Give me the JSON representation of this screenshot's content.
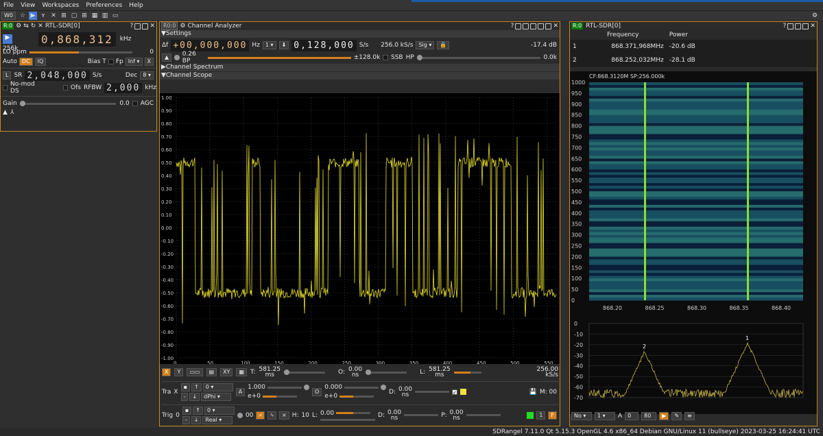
{
  "menu": [
    "File",
    "View",
    "Workspaces",
    "Preferences",
    "Help"
  ],
  "toolbar": {
    "workspace": "W0"
  },
  "rx": {
    "badge": "R:0",
    "device": "RTL-SDR[0]",
    "rate": "256k",
    "freq": "0,868,312",
    "freq_unit": "kHz",
    "lo_label": "LO ppm",
    "lo_value": "0",
    "auto": "Auto",
    "dc": "DC",
    "iq": "IQ",
    "biast": "Bias T",
    "fp": "Fp",
    "inf": "Inf",
    "x": "X",
    "l": "L",
    "sr": "SR",
    "sr_value": "2,048,000",
    "sr_unit": "S/s",
    "dec": "Dec",
    "dec_value": "8",
    "nomod": "No-mod DS",
    "ofs": "Ofs",
    "rfbw": "RFBW",
    "rfbw_value": "2,000",
    "rfbw_unit": "kHz",
    "gain": "Gain",
    "gain_value": "0.0",
    "agc": "AGC"
  },
  "ca": {
    "badge": "R0:0",
    "title": "Channel Analyzer",
    "settings": "Settings",
    "df": "Δf",
    "df_value": "+00,000,000",
    "hz": "Hz",
    "step": "1",
    "rate_value": "0,128,000",
    "rate_unit": "S/s",
    "rate_sel": "256.0 kS/s",
    "sig": "Sig",
    "db": "-17.4 dB",
    "bp": "0.26 BP",
    "bw": "±128.0k",
    "ssb": "SSB",
    "hp": "HP",
    "hp_val": "0.0k",
    "spectrum": "Channel Spectrum",
    "scope": "Channel Scope",
    "y_ticks": [
      "1.00",
      "0.90",
      "0.80",
      "0.70",
      "0.60",
      "0.50",
      "0.40",
      "0.30",
      "0.20",
      "0.10",
      "0.00",
      "-0.10",
      "-0.20",
      "-0.30",
      "-0.40",
      "-0.50",
      "-0.60",
      "-0.70",
      "-0.80",
      "-0.90",
      "-1.00"
    ],
    "x_ticks": [
      "0",
      "50",
      "100",
      "150",
      "200",
      "250",
      "300",
      "350",
      "400",
      "450",
      "500",
      "550"
    ],
    "controls": {
      "xbtn": "X",
      "ybtn": "Y",
      "xy": "XY",
      "t_label": "T:",
      "t_val": "581.25",
      "t_unit": "ms",
      "o_label": "O:",
      "o_val": "0.00",
      "o_unit": "ns",
      "l_label": "L:",
      "l_val": "581.25",
      "l_unit": "ms",
      "rate": "256.00",
      "rate_unit": "kS/s",
      "tra": "Tra",
      "tra_x": "X",
      "tra_sel": "0",
      "dphi": "dPhi",
      "a": "A",
      "a_val": "1.000",
      "e0": "e+0",
      "o2": "O",
      "o2_val": "0.000",
      "e0b": "e+0",
      "d": "D:",
      "d_val": "0.00",
      "d_unit": "ns",
      "m": "M: 00",
      "trig": "Trig",
      "trig_n": "0",
      "trig_sel": "0",
      "real": "Real",
      "trig_cnt": "00",
      "h": "H:",
      "h_val": "10",
      "l2": "L:",
      "l2_val": "0.00",
      "d2": "D:",
      "d2_val": "0.00",
      "d2_unit": "ns",
      "p": "P:",
      "p_val": "0.00",
      "p_unit": "ns",
      "one": "1",
      "f": "F"
    }
  },
  "sa": {
    "badge": "R:0",
    "device": "RTL-SDR[0]",
    "cols": [
      "Frequency",
      "Power"
    ],
    "rows": [
      {
        "n": "1",
        "freq": "868.371,968MHz",
        "pow": "-20.6 dB"
      },
      {
        "n": "2",
        "freq": "868.252,032MHz",
        "pow": "-28.1 dB"
      }
    ],
    "wf_header": "CF:868.3120M SP:256.000k",
    "wf_y": [
      "1000",
      "950",
      "900",
      "850",
      "800",
      "750",
      "700",
      "650",
      "600",
      "550",
      "500",
      "450",
      "400",
      "350",
      "300",
      "250",
      "200",
      "150",
      "100",
      "50",
      "0"
    ],
    "freq_ticks": [
      "868.20",
      "868.25",
      "868.30",
      "868.35",
      "868.40"
    ],
    "spec_y": [
      "0",
      "-10",
      "-20",
      "-30",
      "-40",
      "-50",
      "-60",
      "-70"
    ],
    "marker1": "1",
    "marker2": "2",
    "bottom": {
      "no": "No",
      "one": "1",
      "a": "A",
      "a_val": "0",
      "eighty": "80"
    }
  },
  "status": "SDRangel 7.11.0 Qt 5.15.3 OpenGL 4.6 x86_64 Debian GNU/Linux 11 (bullseye)  2023-03-25 16:24:41 UTC"
}
